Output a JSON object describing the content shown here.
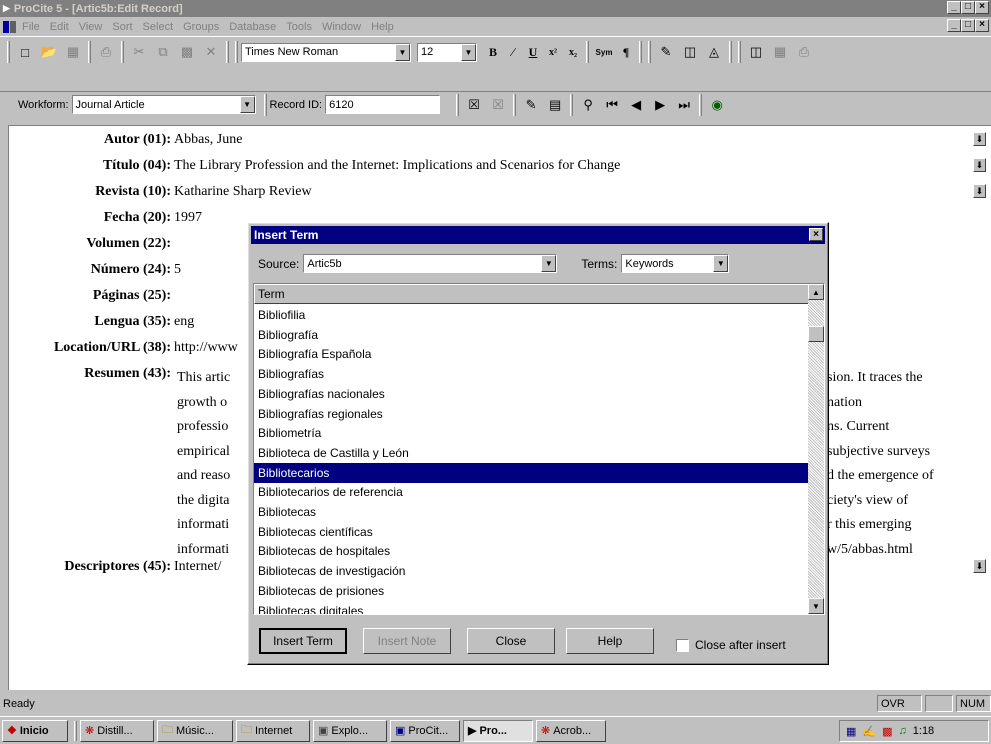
{
  "window": {
    "title": "ProCite 5 - [Artic5b:Edit Record]",
    "min": "_",
    "max": "□",
    "close": "×"
  },
  "menu": [
    "File",
    "Edit",
    "View",
    "Sort",
    "Select",
    "Groups",
    "Database",
    "Tools",
    "Window",
    "Help"
  ],
  "toolbar": {
    "font_name": "Times New Roman",
    "font_size": "12",
    "bold": "B",
    "italic": "∕",
    "underline": "U",
    "superscript": "x²",
    "subscript": "x₂",
    "sym": "Sym",
    "pilcrow": "¶"
  },
  "recordbar": {
    "workform_label": "Workform:",
    "workform_value": "Journal Article",
    "record_id_label": "Record ID:",
    "record_id_value": "6120"
  },
  "record": {
    "fields": [
      {
        "label": "Autor (01):",
        "value": "Abbas, June"
      },
      {
        "label": "Título (04):",
        "value": "The Library Profession and the Internet: Implications and Scenarios for Change"
      },
      {
        "label": "Revista (10):",
        "value": "Katharine Sharp Review"
      },
      {
        "label": "Fecha (20):",
        "value": "1997"
      },
      {
        "label": "Volumen (22):",
        "value": ""
      },
      {
        "label": "Número (24):",
        "value": "5"
      },
      {
        "label": "Páginas (25):",
        "value": ""
      },
      {
        "label": "Lengua (35):",
        "value": "eng"
      },
      {
        "label": "Location/URL (38):",
        "value": "http://www"
      },
      {
        "label": "Resumen (43):",
        "value": ""
      },
      {
        "label": "Descriptores (45):",
        "value": "Internet/"
      }
    ],
    "abstract_left": [
      "This artic",
      "growth o",
      "professio",
      "empirical",
      "and reaso",
      "the digita",
      "informati",
      "informati"
    ],
    "abstract_right": [
      "sion. It traces the",
      "nation",
      "ns. Current",
      "subjective surveys",
      "d the emergence of",
      "ciety's view of",
      "r this emerging",
      "w/5/abbas.html"
    ]
  },
  "dialog": {
    "title": "Insert Term",
    "source_label": "Source:",
    "source_value": "Artic5b",
    "terms_label": "Terms:",
    "terms_value": "Keywords",
    "column_header": "Term",
    "items": [
      "Bibliofilia",
      "Bibliografía",
      "Bibliografía Española",
      "Bibliografías",
      "Bibliografías nacionales",
      "Bibliografías regionales",
      "Bibliometría",
      "Biblioteca de Castilla y León",
      "Bibliotecarios",
      "Bibliotecarios de referencia",
      "Bibliotecas",
      "Bibliotecas científicas",
      "Bibliotecas de hospitales",
      "Bibliotecas de investigación",
      "Bibliotecas de prisiones",
      "Bibliotecas digitales"
    ],
    "selected_index": 8,
    "buttons": {
      "insert_term": "Insert Term",
      "insert_note": "Insert Note",
      "close": "Close",
      "help": "Help"
    },
    "checkbox_label": "Close after insert"
  },
  "status": {
    "text": "Ready",
    "ovr": "OVR",
    "num": "NUM"
  },
  "taskbar": {
    "start": "Inicio",
    "tasks": [
      "Distill...",
      "Músic...",
      "Internet",
      "Explo...",
      "ProCit...",
      "Pro...",
      "Acrob..."
    ],
    "active_index": 5,
    "clock": "1:18"
  }
}
